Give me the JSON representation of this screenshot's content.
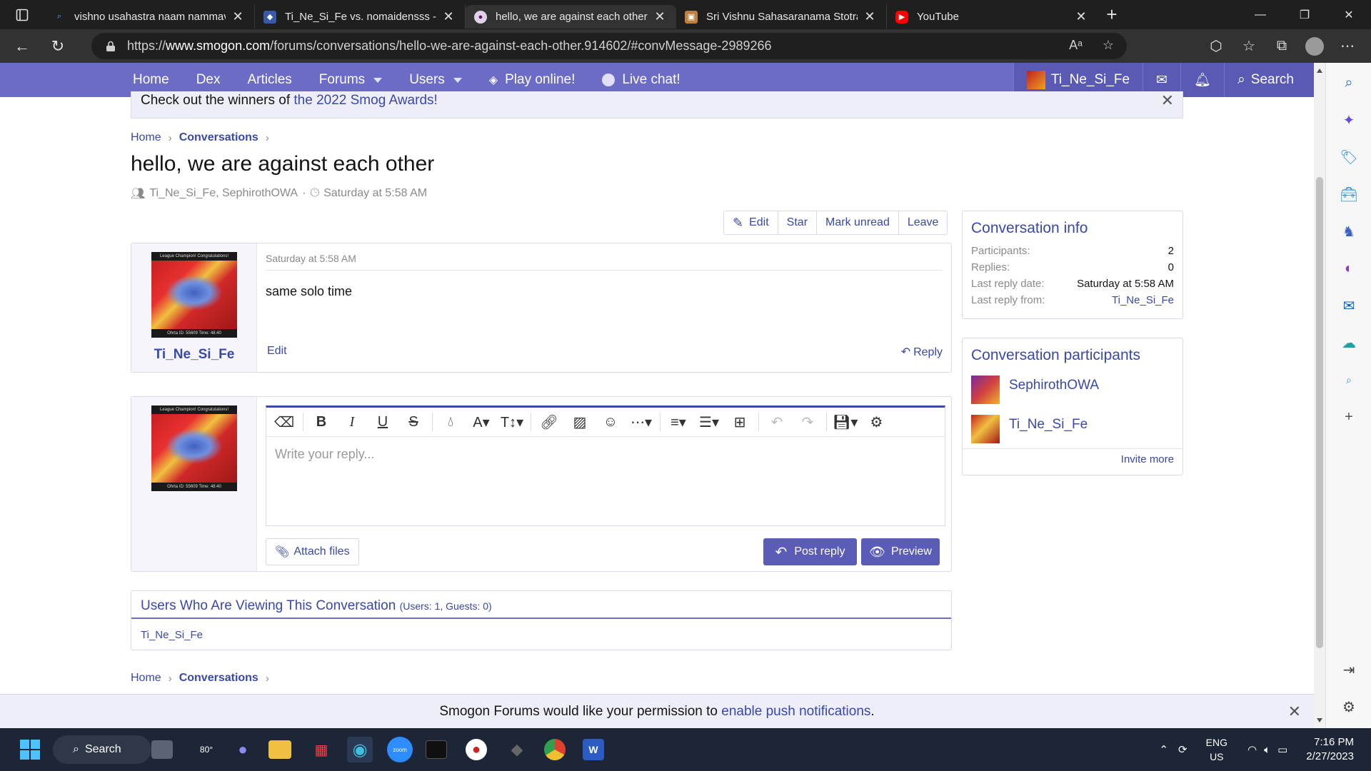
{
  "browser": {
    "tabs": [
      {
        "title": "vishno usahastra naam nammava",
        "fav": "search-favicon",
        "color": "#1a3a6a"
      },
      {
        "title": "Ti_Ne_Si_Fe vs. nomaidensss - Sh",
        "fav": "showdown-favicon",
        "color": "#3a4a8a"
      },
      {
        "title": "hello, we are against each other |",
        "fav": "smogon-favicon",
        "color": "#6a1a6a",
        "active": true
      },
      {
        "title": "Sri Vishnu Sahasaranama Stotram",
        "fav": "image-favicon",
        "color": "#a06030"
      },
      {
        "title": "YouTube",
        "fav": "youtube-favicon",
        "color": "#ff0000"
      }
    ],
    "url_prefix": "https://",
    "url_host": "www.smogon.com",
    "url_path": "/forums/conversations/hello-we-are-against-each-other.914602/#convMessage-2989266"
  },
  "nav": {
    "items": [
      "Home",
      "Dex",
      "Articles",
      "Forums",
      "Users",
      "Play online!",
      "Live chat!"
    ],
    "username": "Ti_Ne_Si_Fe",
    "search": "Search"
  },
  "notice": {
    "prefix": "Check out the winners of ",
    "link": "the 2022 Smog Awards!"
  },
  "breadcrumb": {
    "home": "Home",
    "current": "Conversations"
  },
  "page": {
    "title": "hello, we are against each other",
    "participants": "Ti_Ne_Si_Fe, SephirothOWA",
    "date": "Saturday at 5:58 AM"
  },
  "actions": [
    "Edit",
    "Star",
    "Mark unread",
    "Leave"
  ],
  "message": {
    "author": "Ti_Ne_Si_Fe",
    "date": "Saturday at 5:58 AM",
    "text": "same solo time",
    "edit": "Edit",
    "reply": "Reply",
    "avatar_caption_top": "League Champion! Congratulations!",
    "avatar_caption_bottom": "Ohrta ID: 55609  Time: 48:40"
  },
  "editor": {
    "placeholder": "Write your reply...",
    "attach": "Attach files",
    "post": "Post reply",
    "preview": "Preview"
  },
  "viewers": {
    "title": "Users Who Are Viewing This Conversation",
    "count": "(Users: 1, Guests: 0)",
    "user": "Ti_Ne_Si_Fe"
  },
  "info": {
    "title": "Conversation info",
    "rows": [
      {
        "k": "Participants:",
        "v": "2"
      },
      {
        "k": "Replies:",
        "v": "0"
      },
      {
        "k": "Last reply date:",
        "v": "Saturday at 5:58 AM"
      },
      {
        "k": "Last reply from:",
        "v": "Ti_Ne_Si_Fe"
      }
    ]
  },
  "participants_box": {
    "title": "Conversation participants",
    "users": [
      "SephirothOWA",
      "Ti_Ne_Si_Fe"
    ],
    "invite": "Invite more"
  },
  "push": {
    "text": "Smogon Forums would like your permission to ",
    "link": "enable push notifications",
    "suffix": "."
  },
  "taskbar": {
    "search": "Search",
    "weather": "80°",
    "lang1": "ENG",
    "lang2": "US",
    "time": "7:16 PM",
    "date": "2/27/2023"
  }
}
